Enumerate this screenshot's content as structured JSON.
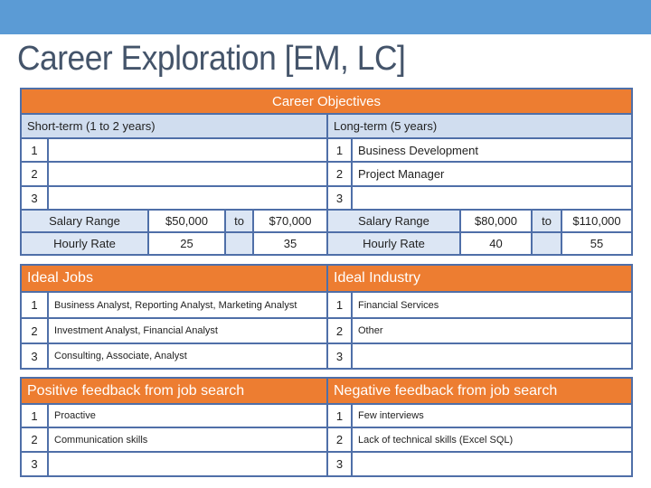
{
  "slide": {
    "title": "Career Exploration [EM, LC]",
    "colors": {
      "topbar": "#5b9bd5",
      "header": "#ed7d31",
      "subheader": "#d0ddef",
      "border": "#4f6fa8",
      "title": "#44546a"
    }
  },
  "objectives": {
    "header": "Career Objectives",
    "short_term": {
      "label": "Short-term (1 to 2 years)",
      "items": [
        {
          "num": "1",
          "text": ""
        },
        {
          "num": "2",
          "text": ""
        },
        {
          "num": "3",
          "text": ""
        }
      ],
      "salary": {
        "label": "Salary Range",
        "min": "$50,000",
        "to": "to",
        "max": "$70,000"
      },
      "hourly": {
        "label": "Hourly Rate",
        "min": "25",
        "max": "35"
      }
    },
    "long_term": {
      "label": "Long-term (5 years)",
      "items": [
        {
          "num": "1",
          "text": "Business Development"
        },
        {
          "num": "2",
          "text": "Project Manager"
        },
        {
          "num": "3",
          "text": ""
        }
      ],
      "salary": {
        "label": "Salary Range",
        "min": "$80,000",
        "to": "to",
        "max": "$110,000"
      },
      "hourly": {
        "label": "Hourly Rate",
        "min": "40",
        "max": "55"
      }
    }
  },
  "ideal": {
    "jobs": {
      "header": "Ideal Jobs",
      "items": [
        {
          "num": "1",
          "text": "Business Analyst, Reporting Analyst, Marketing Analyst"
        },
        {
          "num": "2",
          "text": "Investment Analyst, Financial Analyst"
        },
        {
          "num": "3",
          "text": "Consulting, Associate, Analyst"
        }
      ]
    },
    "industry": {
      "header": "Ideal Industry",
      "items": [
        {
          "num": "1",
          "text": "Financial Services"
        },
        {
          "num": "2",
          "text": "Other"
        },
        {
          "num": "3",
          "text": ""
        }
      ]
    }
  },
  "feedback": {
    "positive": {
      "header": "Positive feedback from job search",
      "items": [
        {
          "num": "1",
          "text": "Proactive"
        },
        {
          "num": "2",
          "text": "Communication skills"
        },
        {
          "num": "3",
          "text": ""
        }
      ]
    },
    "negative": {
      "header": "Negative feedback from job search",
      "items": [
        {
          "num": "1",
          "text": "Few interviews"
        },
        {
          "num": "2",
          "text": "Lack of technical skills (Excel SQL)"
        },
        {
          "num": "3",
          "text": ""
        }
      ]
    }
  }
}
